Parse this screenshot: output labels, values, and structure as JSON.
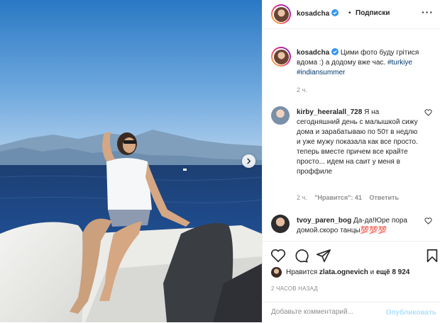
{
  "header": {
    "username": "kosadcha",
    "separator": "•",
    "follow_label": "Подписки",
    "more_label": "···"
  },
  "caption": {
    "username": "kosadcha",
    "text": "Цими фото буду грітися вдома :) а додому вже час.",
    "hashtags": "#turkiye #indiansummer",
    "time": "2 ч."
  },
  "comments": [
    {
      "username": "kirby_heeralall_728",
      "text": "Я на сегодняшний день с малышкой сижу дома и зарабатываю по 50т в недлю и уже мужу показала как все просто. теперь вместе причем все крайте просто... идем на саит у меня в проффиле",
      "time": "2 ч.",
      "likes": "\"Нравится\": 41",
      "reply": "Ответить"
    },
    {
      "username": "tvoy_paren_bog",
      "text": "Да-да!Юре пора домой.скоро танцы💯💯💯"
    }
  ],
  "likes": {
    "prefix": "Нравится",
    "user": "zlata.ognevich",
    "connector": "и",
    "others": "ещё 8 924"
  },
  "posted_ago": "2 ЧАСОВ НАЗАД",
  "add_comment": {
    "placeholder": "Добавьте комментарий...",
    "publish_label": "Опубликовать"
  },
  "colors": {
    "hashtag": "#00376b",
    "verified": "#3897f0",
    "publish_disabled": "#b2dffc",
    "muted": "#8e8e8e"
  }
}
